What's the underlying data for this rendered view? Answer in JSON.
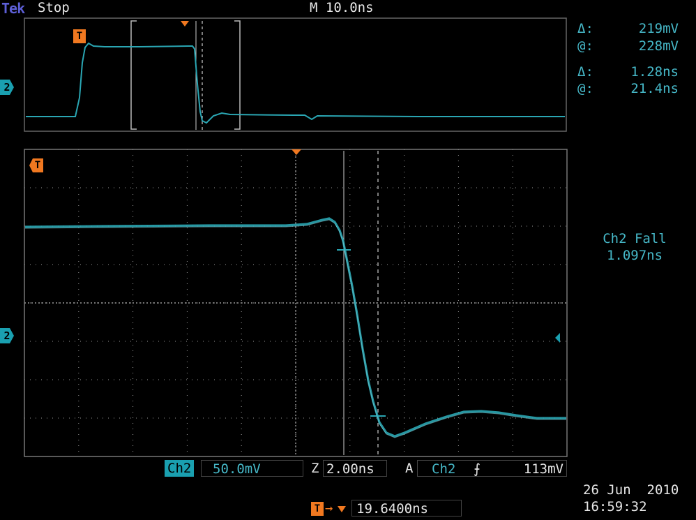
{
  "header": {
    "brand": "Tek",
    "acq_status": "Stop",
    "timebase": "M 10.0ns"
  },
  "cursors": {
    "voltage_delta_label": "Δ:",
    "voltage_delta_value": "219mV",
    "voltage_at_label": "@:",
    "voltage_at_value": "228mV",
    "time_delta_label": "Δ:",
    "time_delta_value": "1.28ns",
    "time_at_label": "@:",
    "time_at_value": "21.4ns"
  },
  "measurement": {
    "name": "Ch2 Fall",
    "value": "1.097ns"
  },
  "channel": {
    "label": "Ch2",
    "scale": "50.0mV",
    "zoom_label": "Z",
    "zoom_scale": "2.00ns",
    "trigger_label": "A",
    "trigger_source": "Ch2",
    "trigger_slope": "⨍",
    "trigger_level": "113mV",
    "ref_marker": "2"
  },
  "trigger_position": {
    "marker": "T",
    "value": "19.6400ns"
  },
  "datetime": {
    "date": "26 Jun  2010",
    "time": "16:59:32"
  },
  "colors": {
    "trace": "#2aa6b3",
    "accent_trigger": "#f07820",
    "grid": "#9a9a9a",
    "brand": "#5d5fd6"
  }
}
